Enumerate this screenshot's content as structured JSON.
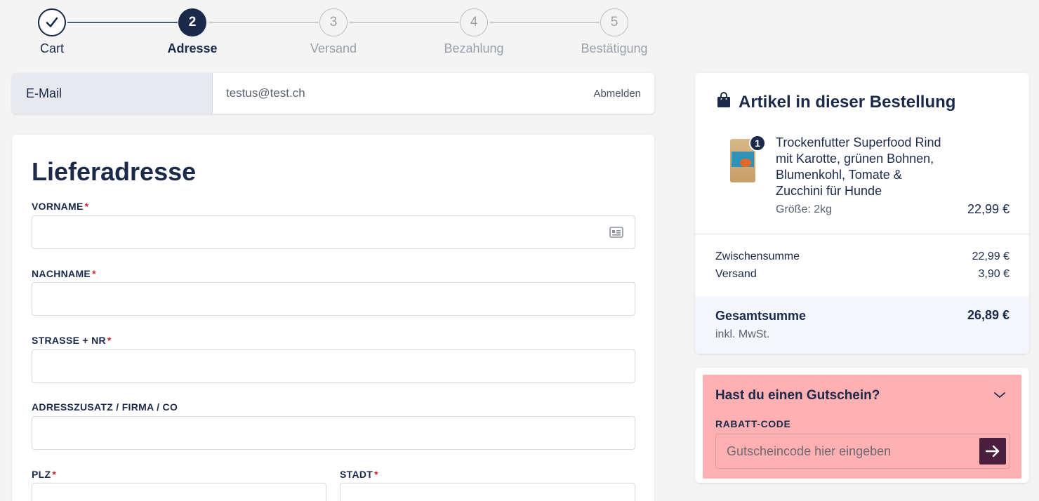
{
  "stepper": {
    "steps": [
      {
        "number": "",
        "label": "Cart",
        "state": "done"
      },
      {
        "number": "2",
        "label": "Adresse",
        "state": "active"
      },
      {
        "number": "3",
        "label": "Versand",
        "state": "pending"
      },
      {
        "number": "4",
        "label": "Bezahlung",
        "state": "pending"
      },
      {
        "number": "5",
        "label": "Bestätigung",
        "state": "pending"
      }
    ]
  },
  "email": {
    "label": "E-Mail",
    "value": "testus@test.ch",
    "logout_label": "Abmelden"
  },
  "address": {
    "title": "Lieferadresse",
    "required_marker": "*",
    "fields": {
      "firstname": {
        "label": "VORNAME",
        "required": true,
        "value": ""
      },
      "lastname": {
        "label": "NACHNAME",
        "required": true,
        "value": ""
      },
      "street": {
        "label": "STRASSE + NR",
        "required": true,
        "value": ""
      },
      "addition": {
        "label": "ADRESSZUSATZ / FIRMA / CO",
        "required": false,
        "value": ""
      },
      "zip": {
        "label": "PLZ",
        "required": true,
        "value": ""
      },
      "city": {
        "label": "STADT",
        "required": true,
        "value": ""
      }
    }
  },
  "summary": {
    "title": "Artikel in dieser Bestellung",
    "item": {
      "quantity": "1",
      "name": "Trockenfutter Superfood Rind mit Karotte, grünen Bohnen, Blumenkohl, Tomate & Zucchini für Hunde",
      "size": "Größe: 2kg",
      "price": "22,99 €"
    },
    "subtotal_label": "Zwischensumme",
    "subtotal_value": "22,99 €",
    "shipping_label": "Versand",
    "shipping_value": "3,90 €",
    "total_label": "Gesamtsumme",
    "total_value": "26,89 €",
    "vat_note": "inkl. MwSt."
  },
  "voucher": {
    "title": "Hast du einen Gutschein?",
    "code_label": "RABATT-CODE",
    "placeholder": "Gutscheincode hier eingeben"
  },
  "colors": {
    "primary": "#1b2a4a",
    "required": "#d4232f",
    "voucher_bg": "#ffb0b3",
    "voucher_button": "#4a1f3e"
  }
}
